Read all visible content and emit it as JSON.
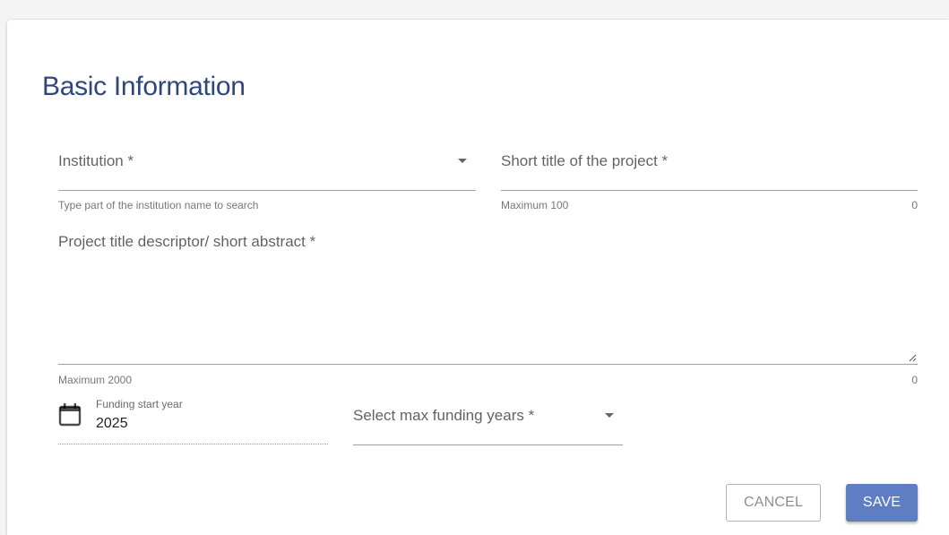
{
  "form": {
    "heading": "Basic Information",
    "institution": {
      "label": "Institution *",
      "helper": "Type part of the institution name to search"
    },
    "short_title": {
      "label": "Short title of the project *",
      "helper": "Maximum 100",
      "count": "0"
    },
    "abstract": {
      "label": "Project title descriptor/ short abstract *",
      "helper": "Maximum 2000",
      "count": "0"
    },
    "funding_start_year": {
      "label": "Funding start year",
      "value": "2025"
    },
    "max_funding_years": {
      "label": "Select max funding years *"
    },
    "actions": {
      "cancel_label": "CANCEL",
      "save_label": "SAVE"
    }
  },
  "colors": {
    "heading": "#2f4779",
    "primary_button": "#5e7dc3"
  },
  "icons": {
    "dropdown": "chevron-down-icon",
    "calendar": "calendar-icon",
    "resize": "resize-handle-icon"
  }
}
